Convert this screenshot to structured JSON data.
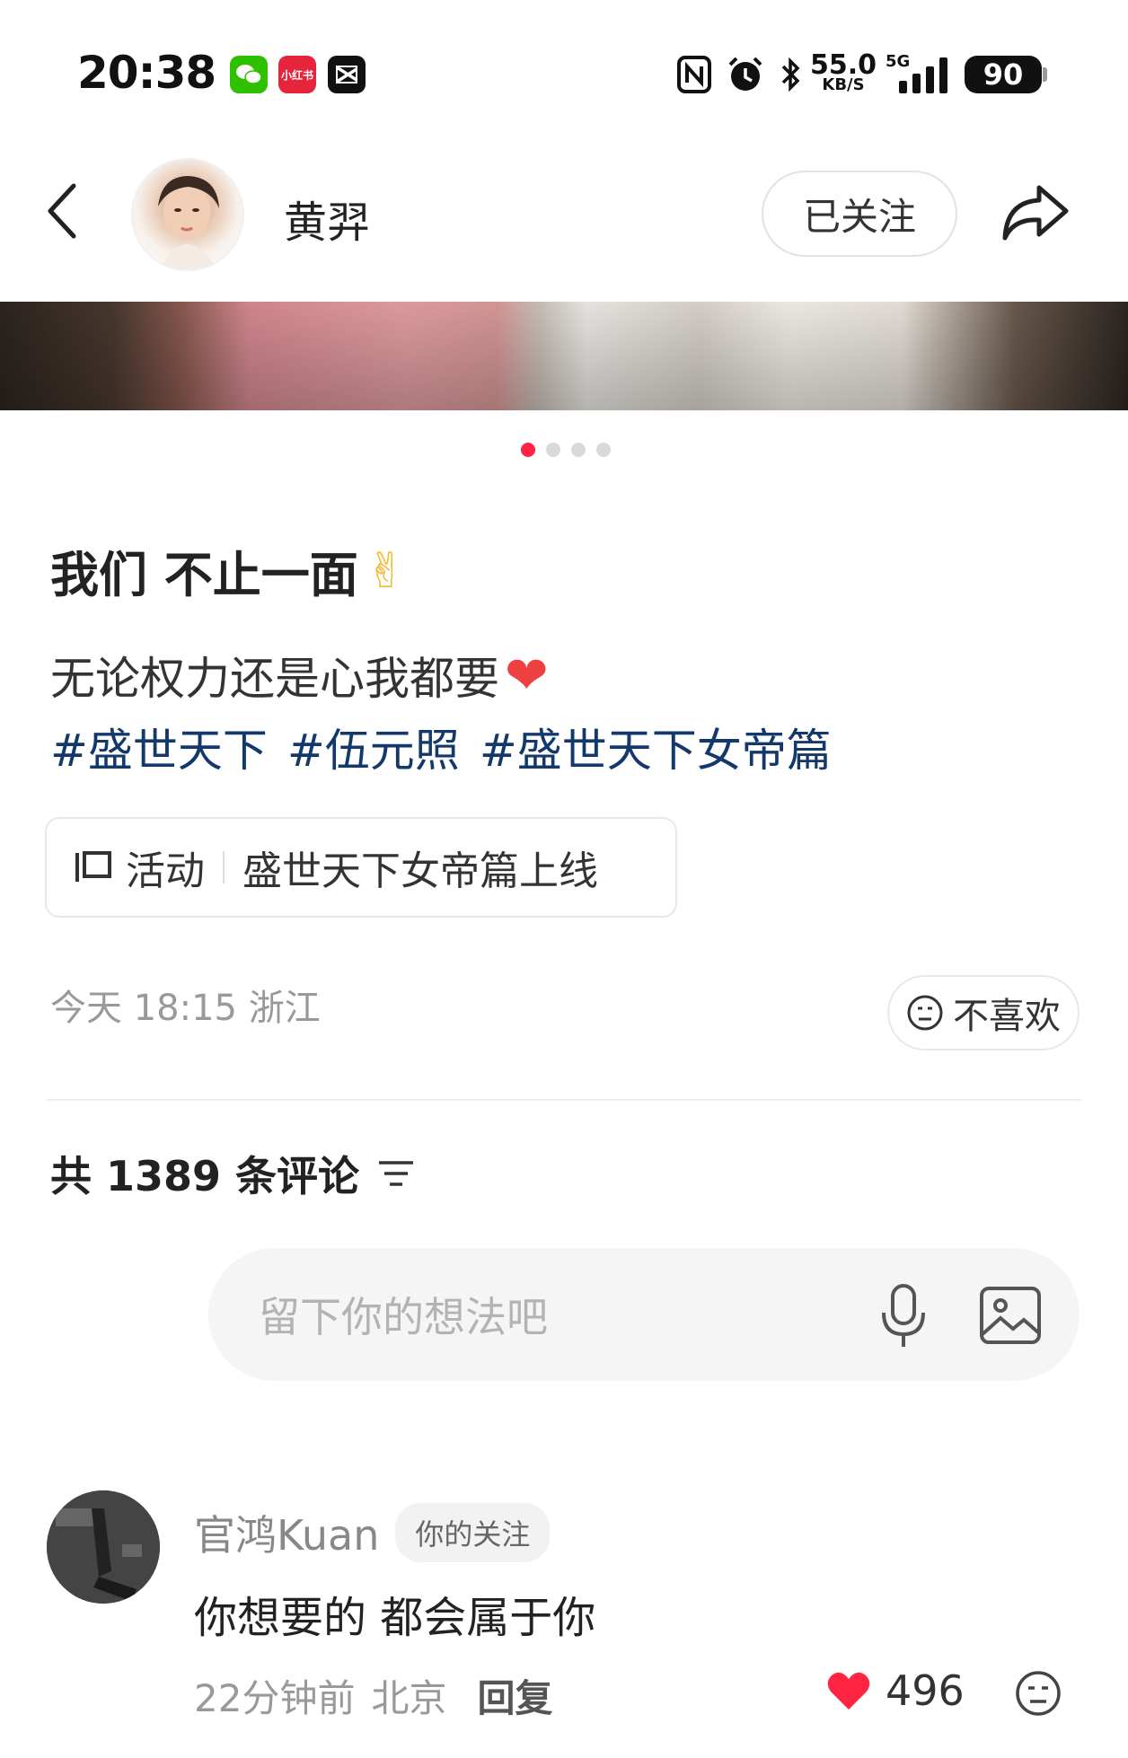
{
  "status_bar": {
    "time": "20:38",
    "apps": [
      {
        "icon": "wechat-icon",
        "color": "#2dc100"
      },
      {
        "icon": "xiaohongshu-icon",
        "label": "小红书",
        "color": "#e6253c"
      },
      {
        "icon": "capcut-icon",
        "color": "#111111"
      }
    ],
    "net_speed_value": "55.0",
    "net_speed_unit": "KB/S",
    "network": "5G",
    "battery": "90"
  },
  "header": {
    "author_name": "黄羿",
    "follow_label": "已关注"
  },
  "carousel": {
    "total": 4,
    "active_index": 0,
    "active_color": "#ff2442"
  },
  "post": {
    "title": "我们 不止一面",
    "title_emoji": "✌",
    "body": "无论权力还是心我都要",
    "body_emoji": "❤",
    "tags": [
      "#盛世天下",
      "#伍元照",
      "#盛世天下女帝篇"
    ],
    "tag_color": "#13386c",
    "activity_label": "活动",
    "activity_title": "盛世天下女帝篇上线",
    "meta": "今天 18:15 浙江",
    "dislike_label": "不喜欢"
  },
  "comments_section": {
    "count_text": "共 1389 条评论",
    "input_placeholder": "留下你的想法吧"
  },
  "comments": [
    {
      "user": "官鸿Kuan",
      "badge": "你的关注",
      "text": "你想要的 都会属于你",
      "time": "22分钟前",
      "location": "北京",
      "reply_label": "回复",
      "likes": "496",
      "like_color": "#ff2442"
    }
  ]
}
